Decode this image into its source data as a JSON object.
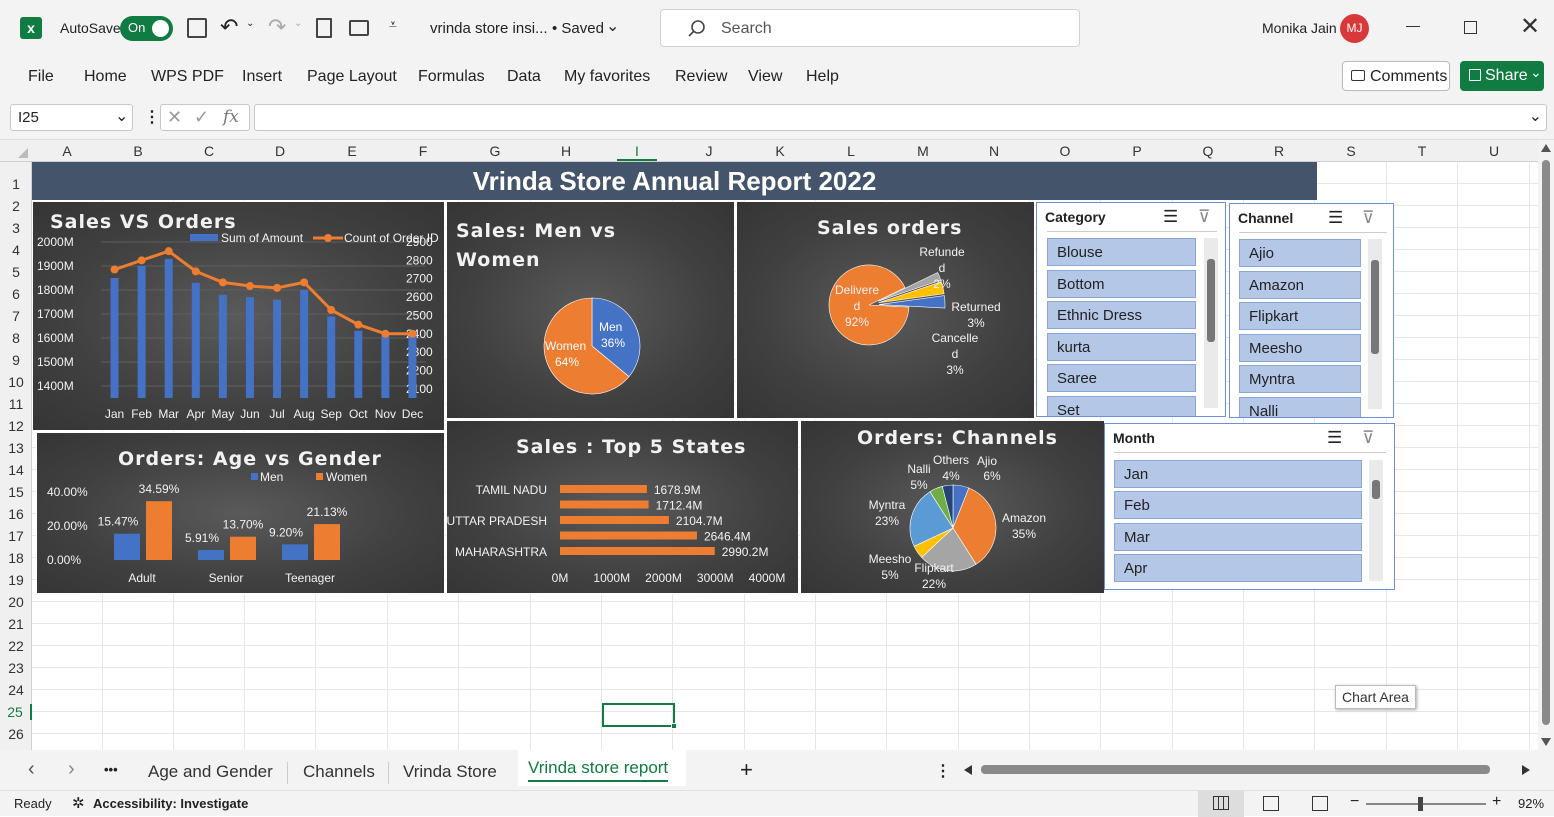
{
  "titlebar": {
    "autosave_label": "AutoSave",
    "autosave_state": "On",
    "file_name": "vrinda store insi...",
    "save_state": "• Saved",
    "search_placeholder": "Search",
    "user_name": "Monika Jain",
    "user_initials": "MJ"
  },
  "ribbon": {
    "tabs": [
      "File",
      "Home",
      "WPS PDF",
      "Insert",
      "Page Layout",
      "Formulas",
      "Data",
      "My favorites",
      "Review",
      "View",
      "Help"
    ],
    "comments_label": "Comments",
    "share_label": "Share"
  },
  "formula_bar": {
    "name_box": "I25",
    "formula": ""
  },
  "grid": {
    "columns": [
      "A",
      "B",
      "C",
      "D",
      "E",
      "F",
      "G",
      "H",
      "I",
      "J",
      "K",
      "L",
      "M",
      "N",
      "O",
      "P",
      "Q",
      "R",
      "S",
      "T",
      "U"
    ],
    "rows": [
      "1",
      "2",
      "3",
      "4",
      "5",
      "6",
      "7",
      "8",
      "9",
      "10",
      "11",
      "12",
      "13",
      "14",
      "15",
      "16",
      "17",
      "18",
      "19",
      "20",
      "21",
      "22",
      "23",
      "24",
      "25",
      "26"
    ],
    "selected_cell": "I25",
    "tooltip": "Chart Area"
  },
  "dashboard": {
    "banner_title": "Vrinda Store Annual Report 2022",
    "colors": {
      "blue": "#4472c4",
      "orange": "#ed7d31",
      "gray": "#a5a5a5",
      "yellow": "#ffc000",
      "lightblue": "#5b9bd5",
      "green": "#70ad47",
      "banner": "#44546a"
    }
  },
  "chart_data": [
    {
      "id": "sales-vs-orders",
      "type": "bar",
      "title": "Sales VS Orders",
      "categories": [
        "Jan",
        "Feb",
        "Mar",
        "Apr",
        "May",
        "Jun",
        "Jul",
        "Aug",
        "Sep",
        "Oct",
        "Nov",
        "Dec"
      ],
      "series": [
        {
          "name": "Sum of Amount",
          "type": "bar",
          "axis": "left",
          "values": [
            1.85,
            1.9,
            1.93,
            1.83,
            1.78,
            1.77,
            1.76,
            1.8,
            1.69,
            1.63,
            1.61,
            1.61
          ]
        },
        {
          "name": "Count of Order ID",
          "type": "line",
          "axis": "right",
          "values": [
            2750,
            2800,
            2850,
            2740,
            2680,
            2660,
            2650,
            2680,
            2530,
            2450,
            2400,
            2400
          ]
        }
      ],
      "y_left_ticks": [
        "1400M",
        "1500M",
        "1600M",
        "1700M",
        "1800M",
        "1900M",
        "2000M"
      ],
      "y_left_range": [
        1.35,
        2.0
      ],
      "y_right_ticks": [
        "2100",
        "2200",
        "2300",
        "2400",
        "2500",
        "2600",
        "2700",
        "2800",
        "2900"
      ],
      "y_right_range": [
        2050,
        2900
      ],
      "legend": "top-right"
    },
    {
      "id": "sales-men-women",
      "type": "pie",
      "title": "Sales: Men vs Women",
      "slices": [
        {
          "label": "Men",
          "value": 36,
          "pct": "36%",
          "color": "#4472c4"
        },
        {
          "label": "Women",
          "value": 64,
          "pct": "64%",
          "color": "#ed7d31"
        }
      ]
    },
    {
      "id": "sales-orders-status",
      "type": "pie",
      "title": "Sales orders",
      "slices": [
        {
          "label": "Delivered",
          "value": 92,
          "pct": "92%",
          "color": "#ed7d31"
        },
        {
          "label": "Refunded",
          "value": 2,
          "pct": "2%",
          "color": "#a5a5a5"
        },
        {
          "label": "Returned",
          "value": 3,
          "pct": "3%",
          "color": "#ffc000"
        },
        {
          "label": "Cancelled",
          "value": 3,
          "pct": "3%",
          "color": "#4472c4"
        }
      ],
      "label_texts": {
        "delivered_a": "Delivere",
        "delivered_b": "d",
        "refunded_a": "Refunde",
        "refunded_b": "d",
        "returned": "Returned",
        "cancelled_a": "Cancelle",
        "cancelled_b": "d"
      }
    },
    {
      "id": "orders-age-gender",
      "type": "bar",
      "title": "Orders: Age vs Gender",
      "categories": [
        "Adult",
        "Senior",
        "Teenager"
      ],
      "series": [
        {
          "name": "Men",
          "values": [
            15.47,
            5.91,
            9.2
          ],
          "labels": [
            "15.47%",
            "5.91%",
            "9.20%"
          ],
          "color": "#4472c4"
        },
        {
          "name": "Women",
          "values": [
            34.59,
            13.7,
            21.13
          ],
          "labels": [
            "34.59%",
            "13.70%",
            "21.13%"
          ],
          "color": "#ed7d31"
        }
      ],
      "y_ticks": [
        "0.00%",
        "20.00%",
        "40.00%"
      ],
      "ylim": [
        0,
        40
      ],
      "legend": "top"
    },
    {
      "id": "sales-top-5-states",
      "type": "bar",
      "orientation": "horizontal",
      "title": "Sales : Top 5 States",
      "categories": [
        "TAMIL NADU",
        "",
        "UTTAR PRADESH",
        "",
        "MAHARASHTRA"
      ],
      "values": [
        1678.9,
        1712.4,
        2104.7,
        2646.4,
        2990.2
      ],
      "value_labels": [
        "1678.9M",
        "1712.4M",
        "2104.7M",
        "2646.4M",
        "2990.2M"
      ],
      "x_ticks": [
        "0M",
        "1000M",
        "2000M",
        "3000M",
        "4000M"
      ],
      "xlim": [
        0,
        4000
      ]
    },
    {
      "id": "orders-channels",
      "type": "pie",
      "title": "Orders: Channels",
      "slices": [
        {
          "label": "Ajio",
          "value": 6,
          "pct": "6%",
          "color": "#4472c4"
        },
        {
          "label": "Amazon",
          "value": 35,
          "pct": "35%",
          "color": "#ed7d31"
        },
        {
          "label": "Flipkart",
          "value": 22,
          "pct": "22%",
          "color": "#a5a5a5"
        },
        {
          "label": "Meesho",
          "value": 5,
          "pct": "5%",
          "color": "#ffc000"
        },
        {
          "label": "Myntra",
          "value": 23,
          "pct": "23%",
          "color": "#5b9bd5"
        },
        {
          "label": "Nalli",
          "value": 5,
          "pct": "5%",
          "color": "#70ad47"
        },
        {
          "label": "Others",
          "value": 4,
          "pct": "4%",
          "color": "#264478"
        }
      ]
    }
  ],
  "slicers": {
    "category": {
      "title": "Category",
      "items": [
        "Blouse",
        "Bottom",
        "Ethnic Dress",
        "kurta",
        "Saree",
        "Set"
      ]
    },
    "channel": {
      "title": "Channel",
      "items": [
        "Ajio",
        "Amazon",
        "Flipkart",
        "Meesho",
        "Myntra",
        "Nalli"
      ]
    },
    "month": {
      "title": "Month",
      "items": [
        "Jan",
        "Feb",
        "Mar",
        "Apr"
      ]
    }
  },
  "sheet_tabs": {
    "tabs": [
      "Age and Gender",
      "Channels",
      "Vrinda Store",
      "Vrinda store report"
    ],
    "active": "Vrinda store report",
    "more": "•••",
    "add": "+"
  },
  "status_bar": {
    "ready": "Ready",
    "accessibility": "Accessibility: Investigate",
    "zoom": "92%"
  }
}
